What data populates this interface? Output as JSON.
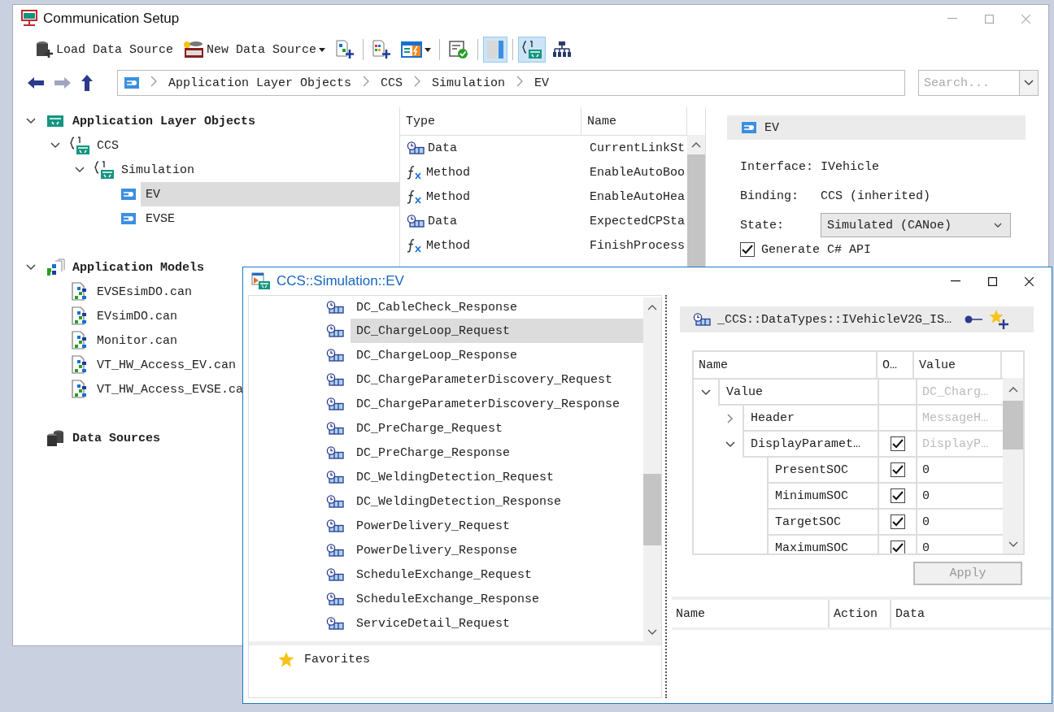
{
  "window": {
    "title": "Communication Setup"
  },
  "toolbar": [
    [
      {
        "kind": "load-source",
        "label": "Load Data Source",
        "dropdown": false,
        "pressed": false
      },
      {
        "kind": "new-source",
        "label": "New Data Source",
        "dropdown": true,
        "pressed": false
      },
      {
        "kind": "hierarchy-add",
        "dropdown": false,
        "pressed": false
      }
    ],
    [
      {
        "kind": "grid-add",
        "dropdown": false,
        "pressed": false
      },
      {
        "kind": "panel-flash",
        "dropdown": true,
        "pressed": false
      }
    ],
    [
      {
        "kind": "check-doc",
        "dropdown": false,
        "pressed": false
      }
    ],
    [
      {
        "kind": "panel-split",
        "dropdown": false,
        "pressed": true
      }
    ],
    [
      {
        "kind": "braces",
        "dropdown": false,
        "pressed": true
      },
      {
        "kind": "network",
        "dropdown": false,
        "pressed": false
      }
    ]
  ],
  "navigation": {
    "breadcrumb": [
      "Application Layer Objects",
      "CCS",
      "Simulation",
      "EV"
    ],
    "search": {
      "placeholder": "Search..."
    }
  },
  "tree": [
    {
      "kind": "objects",
      "label": "Application Layer Objects",
      "expanded": true,
      "selected": false,
      "children": [
        {
          "kind": "namespace",
          "label": "CCS",
          "expanded": true,
          "selected": false,
          "children": [
            {
              "kind": "namespace",
              "label": "Simulation",
              "expanded": true,
              "selected": false,
              "children": [
                {
                  "kind": "interface",
                  "label": "EV",
                  "selected": true
                },
                {
                  "kind": "interface",
                  "label": "EVSE",
                  "selected": false
                }
              ]
            }
          ]
        }
      ]
    },
    {
      "kind": "models",
      "label": "Application Models",
      "expanded": true,
      "selected": false,
      "children": [
        {
          "kind": "file",
          "label": "EVSEsimDO.can",
          "selected": false
        },
        {
          "kind": "file",
          "label": "EVsimDO.can",
          "selected": false
        },
        {
          "kind": "file",
          "label": "Monitor.can",
          "selected": false
        },
        {
          "kind": "file",
          "label": "VT_HW_Access_EV.can",
          "selected": false
        },
        {
          "kind": "file",
          "label": "VT_HW_Access_EVSE.ca",
          "selected": false
        }
      ]
    },
    {
      "kind": "sources",
      "label": "Data Sources",
      "selected": false
    }
  ],
  "members": {
    "columns": [
      "Type",
      "Name"
    ],
    "rows": [
      {
        "kind": "data",
        "type": "Data",
        "name": "CurrentLinkSt"
      },
      {
        "kind": "method",
        "type": "Method",
        "name": "EnableAutoBoo"
      },
      {
        "kind": "method",
        "type": "Method",
        "name": "EnableAutoHea"
      },
      {
        "kind": "data",
        "type": "Data",
        "name": "ExpectedCPSta"
      },
      {
        "kind": "method",
        "type": "Method",
        "name": "FinishProcess"
      }
    ]
  },
  "details": {
    "title": "EV",
    "interface_label": "Interface:",
    "interface": "IVehicle",
    "binding_label": "Binding:",
    "binding": "CCS (inherited)",
    "state_label": "State:",
    "state": "Simulated (CANoe)",
    "generate": {
      "label": "Generate C# API",
      "checked": true
    }
  },
  "popup": {
    "title": "CCS::Simulation::EV",
    "items": [
      {
        "label": "DC_CableCheck_Response",
        "selected": false
      },
      {
        "label": "DC_ChargeLoop_Request",
        "selected": true
      },
      {
        "label": "DC_ChargeLoop_Response",
        "selected": false
      },
      {
        "label": "DC_ChargeParameterDiscovery_Request",
        "selected": false
      },
      {
        "label": "DC_ChargeParameterDiscovery_Response",
        "selected": false
      },
      {
        "label": "DC_PreCharge_Request",
        "selected": false
      },
      {
        "label": "DC_PreCharge_Response",
        "selected": false
      },
      {
        "label": "DC_WeldingDetection_Request",
        "selected": false
      },
      {
        "label": "DC_WeldingDetection_Response",
        "selected": false
      },
      {
        "label": "PowerDelivery_Request",
        "selected": false
      },
      {
        "label": "PowerDelivery_Response",
        "selected": false
      },
      {
        "label": "ScheduleExchange_Request",
        "selected": false
      },
      {
        "label": "ScheduleExchange_Response",
        "selected": false
      },
      {
        "label": "ServiceDetail_Request",
        "selected": false
      }
    ],
    "favorites": "Favorites",
    "type_name": "_CCS::DataTypes::IVehicleV2G_IS…",
    "grid": {
      "columns": [
        "Name",
        "O…",
        "Value"
      ],
      "rows": [
        {
          "name": "Value",
          "value": "DC_Charg…",
          "dimmed": true,
          "expanded": true,
          "children": [
            {
              "name": "Header",
              "value": "MessageH…",
              "dimmed": true,
              "expanded": false
            },
            {
              "name": "DisplayParamet…",
              "value": "DisplayP…",
              "dimmed": true,
              "checked": true,
              "expanded": true,
              "children": [
                {
                  "name": "PresentSOC",
                  "value": "0",
                  "dimmed": false,
                  "checked": true
                },
                {
                  "name": "MinimumSOC",
                  "value": "0",
                  "dimmed": false,
                  "checked": true
                },
                {
                  "name": "TargetSOC",
                  "value": "0",
                  "dimmed": false,
                  "checked": true
                },
                {
                  "name": "MaximumSOC",
                  "value": "0",
                  "dimmed": false,
                  "checked": true
                }
              ]
            }
          ]
        }
      ]
    },
    "apply": {
      "label": "Apply",
      "disabled": true
    },
    "log_columns": [
      "Name",
      "Action",
      "Data"
    ]
  }
}
